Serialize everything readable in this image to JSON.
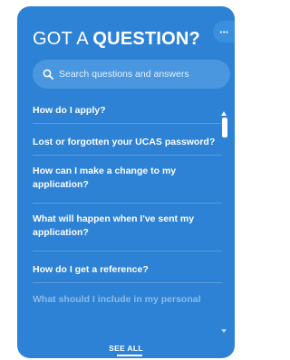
{
  "header": {
    "title_prefix": "GOT A ",
    "title_strong": "QUESTION?",
    "more_label": "···",
    "more_icon": "ellipsis-icon"
  },
  "search": {
    "icon": "search-icon",
    "placeholder": "Search questions and answers"
  },
  "questions": [
    "How do I apply?",
    "Lost or forgotten your UCAS password?",
    "How can I make a change to my application?",
    "What will happen when I've sent my application?",
    "How do I get a reference?",
    "What should I include in my personal"
  ],
  "footer": {
    "see_all_label": "SEE ALL"
  },
  "colors": {
    "panel": "#2d82d5",
    "text": "#ffffff"
  }
}
